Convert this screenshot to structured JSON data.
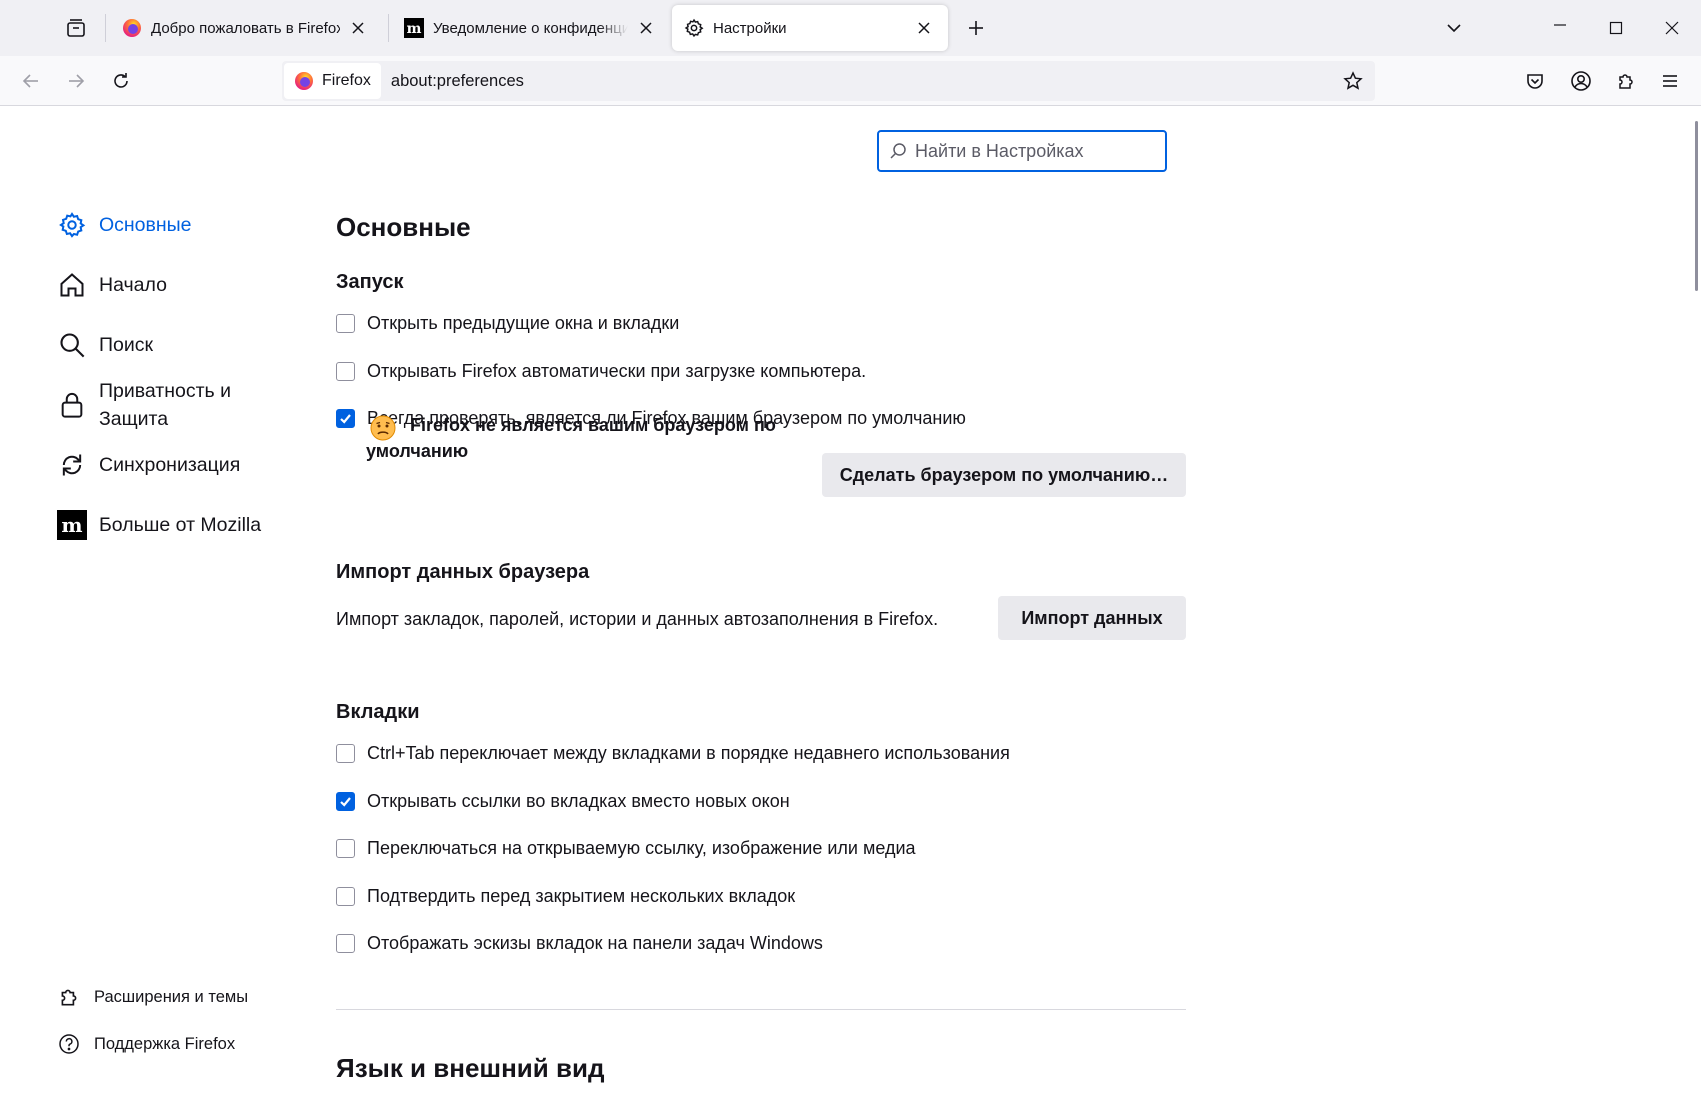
{
  "tabs": [
    {
      "title": "Добро пожаловать в Firefox",
      "selected": false,
      "icon": "firefox-logo-icon"
    },
    {
      "title": "Уведомление о конфиденциальности",
      "selected": false,
      "icon": "mozilla-m-icon"
    },
    {
      "title": "Настройки",
      "selected": true,
      "icon": "gear-icon"
    }
  ],
  "urlbar": {
    "identity_label": "Firefox",
    "url": "about:preferences"
  },
  "search": {
    "placeholder": "Найти в Настройках"
  },
  "sidebar": {
    "categories": [
      {
        "label": "Основные",
        "icon": "gear-icon",
        "selected": true
      },
      {
        "label": "Начало",
        "icon": "home-icon",
        "selected": false
      },
      {
        "label": "Поиск",
        "icon": "search-icon",
        "selected": false
      },
      {
        "label": "Приватность и",
        "label2": "Защита",
        "icon": "lock-icon",
        "selected": false
      },
      {
        "label": "Синхронизация",
        "icon": "sync-icon",
        "selected": false
      },
      {
        "label": "Больше от Mozilla",
        "icon": "mozilla-m-icon",
        "selected": false
      }
    ],
    "footer": [
      {
        "label": "Расширения и темы",
        "icon": "puzzle-icon"
      },
      {
        "label": "Поддержка Firefox",
        "icon": "help-icon"
      }
    ]
  },
  "main": {
    "title": "Основные",
    "startup": {
      "heading": "Запуск",
      "options": [
        {
          "label": "Открыть предыдущие окна и вкладки",
          "checked": false
        },
        {
          "label": "Открывать Firefox автоматически при загрузке компьютера.",
          "checked": false
        },
        {
          "label": "Всегда проверять, является ли Firefox вашим браузером по умолчанию",
          "checked": true
        }
      ],
      "notice_line1": "Firefox не является вашим браузером по",
      "notice_line2": "умолчанию",
      "default_button": "Сделать браузером по умолчанию…"
    },
    "import": {
      "heading": "Импорт данных браузера",
      "description": "Импорт закладок, паролей, истории и данных автозаполнения в Firefox.",
      "button": "Импорт данных"
    },
    "tabs_section": {
      "heading": "Вкладки",
      "options": [
        {
          "label": "Ctrl+Tab переключает между вкладками в порядке недавнего использования",
          "checked": false
        },
        {
          "label": "Открывать ссылки во вкладках вместо новых окон",
          "checked": true
        },
        {
          "label": "Переключаться на открываемую ссылку, изображение или медиа",
          "checked": false
        },
        {
          "label": "Подтвердить перед закрытием нескольких вкладок",
          "checked": false
        },
        {
          "label": "Отображать эскизы вкладок на панели задач Windows",
          "checked": false
        }
      ]
    },
    "language": {
      "heading": "Язык и внешний вид"
    }
  },
  "colors": {
    "accent": "#0061e0",
    "tabstrip_bg": "#f0f0f4",
    "button_bg": "#e9e9ed"
  }
}
